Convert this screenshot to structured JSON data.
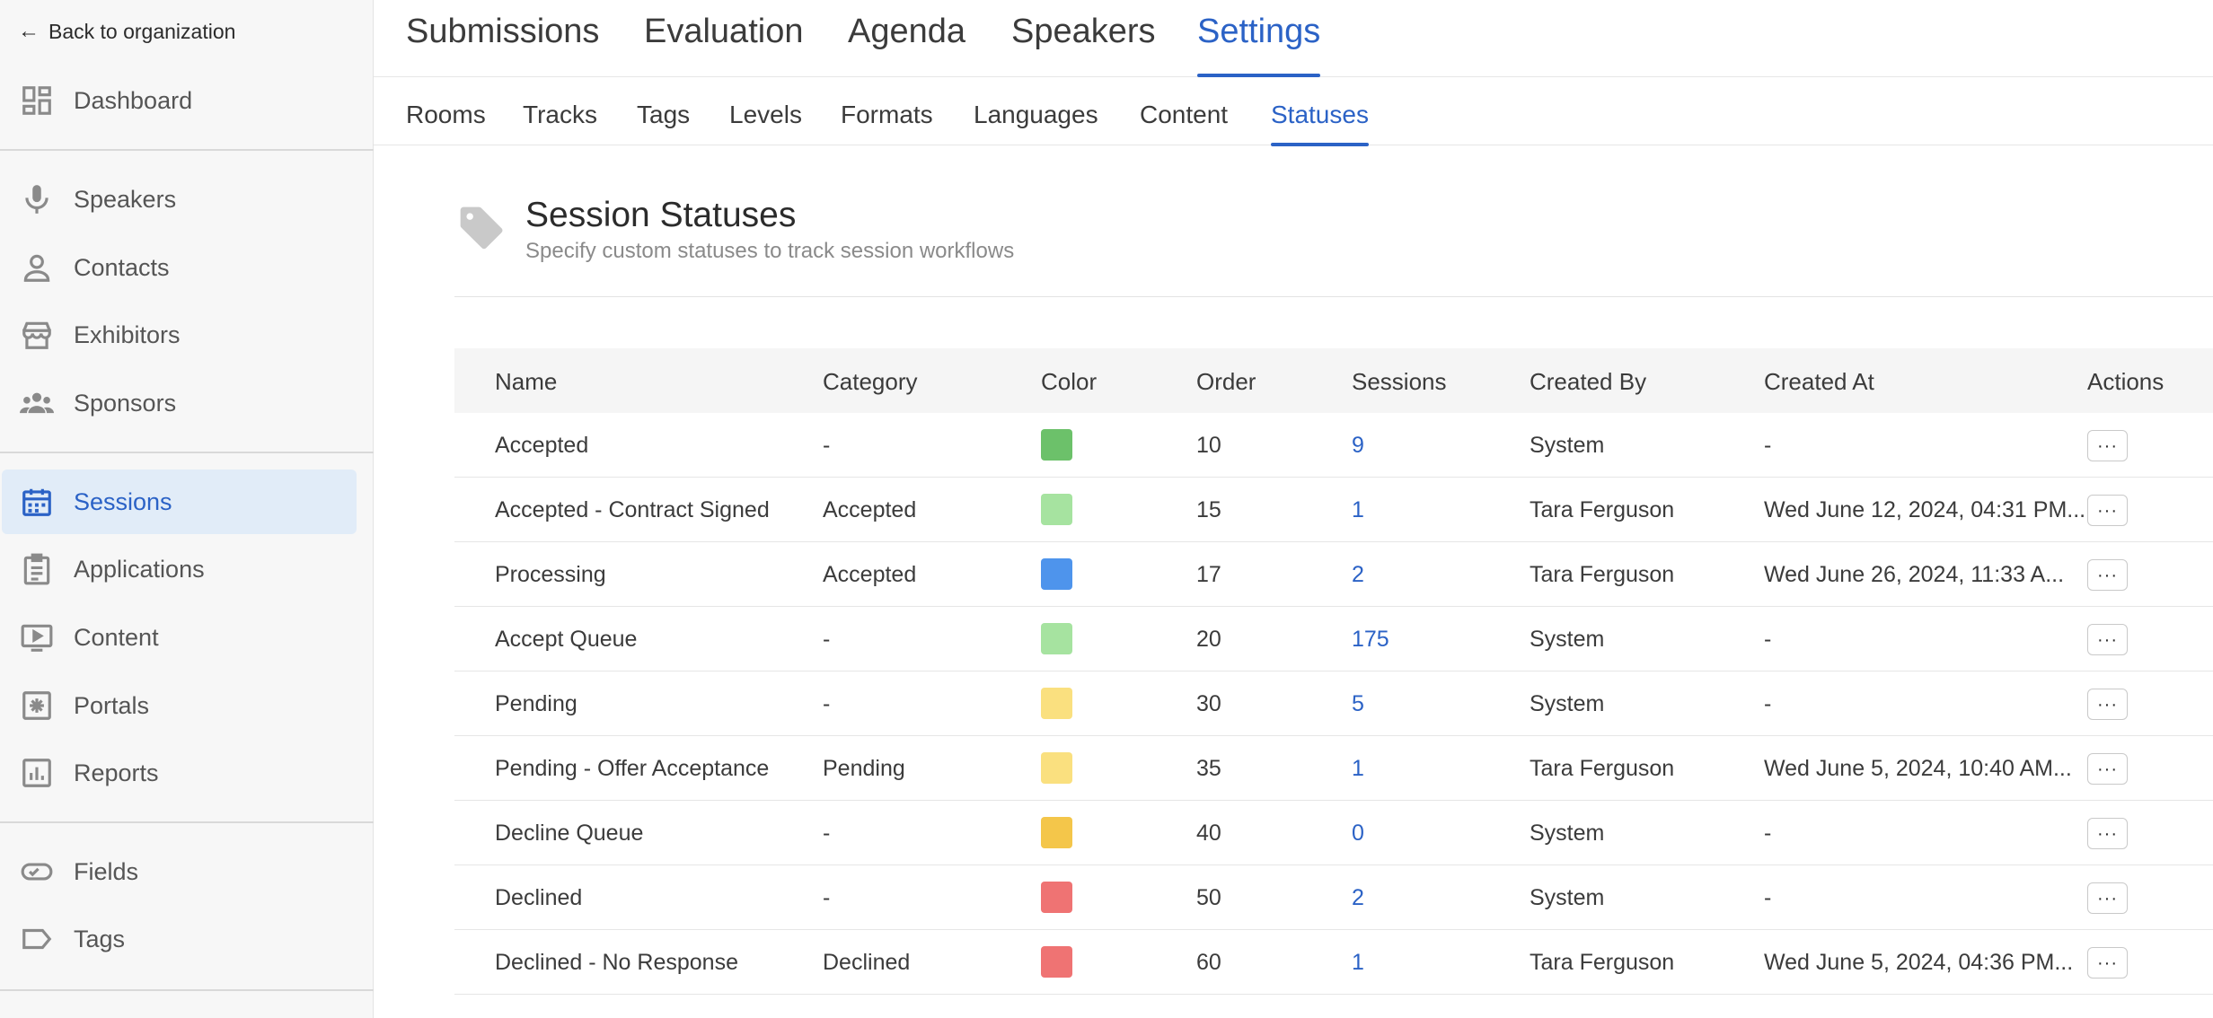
{
  "sidebar": {
    "back_label": "Back to organization",
    "items": [
      {
        "label": "Dashboard",
        "icon": "dashboard-icon"
      },
      {
        "label": "Speakers",
        "icon": "microphone-icon"
      },
      {
        "label": "Contacts",
        "icon": "person-icon"
      },
      {
        "label": "Exhibitors",
        "icon": "storefront-icon"
      },
      {
        "label": "Sponsors",
        "icon": "group-icon"
      },
      {
        "label": "Sessions",
        "icon": "calendar-icon",
        "active": true
      },
      {
        "label": "Applications",
        "icon": "clipboard-icon"
      },
      {
        "label": "Content",
        "icon": "play-screen-icon"
      },
      {
        "label": "Portals",
        "icon": "portal-icon"
      },
      {
        "label": "Reports",
        "icon": "bar-chart-icon"
      },
      {
        "label": "Fields",
        "icon": "toggle-field-icon"
      },
      {
        "label": "Tags",
        "icon": "tag-outline-icon"
      }
    ]
  },
  "topnav": {
    "tabs": [
      "Submissions",
      "Evaluation",
      "Agenda",
      "Speakers",
      "Settings"
    ],
    "active": "Settings"
  },
  "subnav": {
    "tabs": [
      "Rooms",
      "Tracks",
      "Tags",
      "Levels",
      "Formats",
      "Languages",
      "Content",
      "Statuses"
    ],
    "active": "Statuses"
  },
  "header": {
    "title": "Session Statuses",
    "subtitle": "Specify custom statuses to track session workflows",
    "icon": "tag-icon"
  },
  "table": {
    "columns": [
      "Name",
      "Category",
      "Color",
      "Order",
      "Sessions",
      "Created By",
      "Created At",
      "Actions"
    ],
    "action_label": "···",
    "rows": [
      {
        "name": "Accepted",
        "category": "-",
        "color": "#6cc16a",
        "order": "10",
        "sessions": "9",
        "created_by": "System",
        "created_at": "-"
      },
      {
        "name": "Accepted - Contract Signed",
        "category": "Accepted",
        "color": "#a6e3a0",
        "order": "15",
        "sessions": "1",
        "created_by": "Tara Ferguson",
        "created_at": "Wed June 12, 2024, 04:31 PM..."
      },
      {
        "name": "Processing",
        "category": "Accepted",
        "color": "#4e94ec",
        "order": "17",
        "sessions": "2",
        "created_by": "Tara Ferguson",
        "created_at": "Wed June 26, 2024, 11:33 A..."
      },
      {
        "name": "Accept Queue",
        "category": "-",
        "color": "#a6e3a0",
        "order": "20",
        "sessions": "175",
        "created_by": "System",
        "created_at": "-"
      },
      {
        "name": "Pending",
        "category": "-",
        "color": "#fae07f",
        "order": "30",
        "sessions": "5",
        "created_by": "System",
        "created_at": "-"
      },
      {
        "name": "Pending - Offer Acceptance",
        "category": "Pending",
        "color": "#fae07f",
        "order": "35",
        "sessions": "1",
        "created_by": "Tara Ferguson",
        "created_at": "Wed June 5, 2024, 10:40 AM..."
      },
      {
        "name": "Decline Queue",
        "category": "-",
        "color": "#f4c64a",
        "order": "40",
        "sessions": "0",
        "created_by": "System",
        "created_at": "-"
      },
      {
        "name": "Declined",
        "category": "-",
        "color": "#ef7373",
        "order": "50",
        "sessions": "2",
        "created_by": "System",
        "created_at": "-"
      },
      {
        "name": "Declined - No Response",
        "category": "Declined",
        "color": "#ef7373",
        "order": "60",
        "sessions": "1",
        "created_by": "Tara Ferguson",
        "created_at": "Wed June 5, 2024, 04:36 PM..."
      }
    ]
  }
}
